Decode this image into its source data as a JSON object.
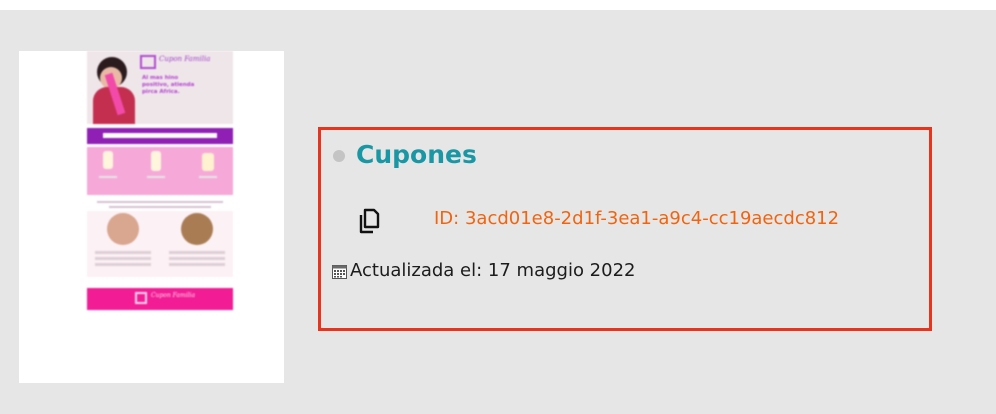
{
  "card": {
    "title": "Cupones",
    "id_text": "ID: 3acd01e8-2d1f-3ea1-a9c4-cc19aecdc812",
    "updated_text": "Actualizada el: 17 maggio 2022",
    "copy_icon": "copy-icon",
    "calendar_icon": "calendar-icon",
    "status": "inactive"
  },
  "thumbnail": {
    "brand_text": "Cupon Familia",
    "headline_text": "Al mas hino positivo, atienda pirca Africa.",
    "footer_brand_text": "Cupon Familia"
  },
  "colors": {
    "title": "#1a97a4",
    "id": "#f0640f",
    "highlight_border": "#e8341c",
    "panel_bg": "#e6e6e6",
    "thumb_magenta": "#f21c94",
    "thumb_purple": "#8f1fb5",
    "thumb_pink": "#f6a9d8"
  }
}
